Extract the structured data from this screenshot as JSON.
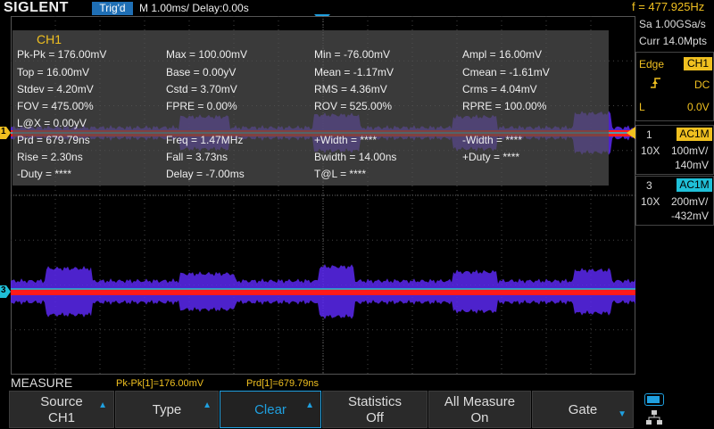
{
  "top": {
    "brand": "SIGLENT",
    "trigger_state": "Trig'd",
    "timebase": "M 1.00ms/ Delay:0.00s",
    "frequency": "f = 477.925Hz"
  },
  "acquisition": {
    "sample_rate": "Sa 1.00GSa/s",
    "memory_depth": "Curr 14.0Mpts"
  },
  "trigger_panel": {
    "type_label": "Edge",
    "source": "CH1",
    "coupling": "DC",
    "level_label": "L",
    "level_value": "0.0V"
  },
  "channels": [
    {
      "number": "1",
      "coupling": "AC1M",
      "probe": "10X",
      "scale": "100mV/",
      "offset": "140mV",
      "color": "#f0c020"
    },
    {
      "number": "3",
      "coupling": "AC1M",
      "probe": "10X",
      "scale": "200mV/",
      "offset": "-432mV",
      "color": "#1fc0d8"
    }
  ],
  "markers": {
    "ch1": "1",
    "ch3": "3"
  },
  "measurements": {
    "source": "CH1",
    "rows": [
      [
        "Pk-Pk = 176.00mV",
        "Max = 100.00mV",
        "Min = -76.00mV",
        "Ampl = 16.00mV"
      ],
      [
        "Top = 16.00mV",
        "Base = 0.00yV",
        "Mean = -1.17mV",
        "Cmean = -1.61mV"
      ],
      [
        "Stdev = 4.20mV",
        "Cstd = 3.70mV",
        "RMS = 4.36mV",
        "Crms = 4.04mV"
      ],
      [
        "FOV = 475.00%",
        "FPRE = 0.00%",
        "ROV = 525.00%",
        "RPRE = 100.00%"
      ],
      [
        "L@X = 0.00yV",
        "",
        "",
        ""
      ],
      [
        "Prd = 679.79ns",
        "Freq = 1.47MHz",
        "+Width = ****",
        "-Width = ****"
      ],
      [
        "Rise = 2.30ns",
        "Fall = 3.73ns",
        "Bwidth = 14.00ns",
        "+Duty = ****"
      ],
      [
        "-Duty = ****",
        "Delay = -7.00ms",
        "T@L = ****",
        ""
      ]
    ]
  },
  "bottom": {
    "menu_title": "MEASURE",
    "quick1": "Pk-Pk[1]=176.00mV",
    "quick2": "Prd[1]=679.79ns",
    "softkeys": [
      {
        "l1": "Source",
        "l2": "CH1"
      },
      {
        "l1": "Type",
        "l2": ""
      },
      {
        "l1": "Clear",
        "l2": ""
      },
      {
        "l1": "Statistics",
        "l2": "Off"
      },
      {
        "l1": "All Measure",
        "l2": "On"
      },
      {
        "l1": "Gate",
        "l2": ""
      }
    ]
  },
  "colors": {
    "trace_envelope": "#5a28f0",
    "trace_center": "#ff1a1a",
    "ch1": "#f0c020",
    "ch3": "#1fc0d8",
    "accent": "#1fa0e0"
  }
}
